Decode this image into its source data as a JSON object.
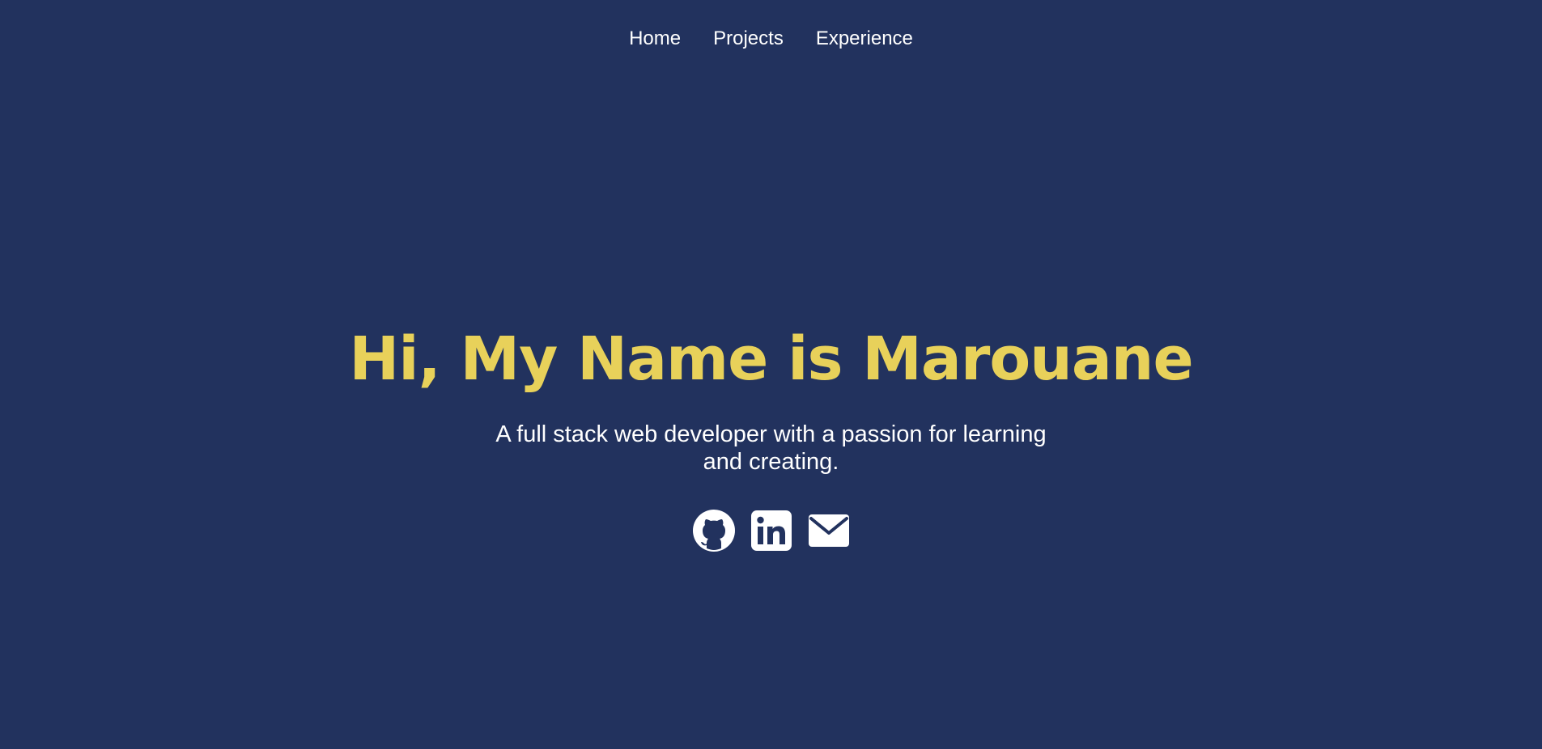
{
  "nav": {
    "items": [
      {
        "label": "Home"
      },
      {
        "label": "Projects"
      },
      {
        "label": "Experience"
      }
    ]
  },
  "hero": {
    "title": "Hi, My Name is Marouane",
    "subtitle": "A full stack web developer with a passion for learning and creating."
  },
  "socials": [
    {
      "icon": "github-icon"
    },
    {
      "icon": "linkedin-icon"
    },
    {
      "icon": "email-icon"
    }
  ],
  "colors": {
    "background": "#22325e",
    "title": "#e8d15a",
    "text": "#ffffff"
  }
}
